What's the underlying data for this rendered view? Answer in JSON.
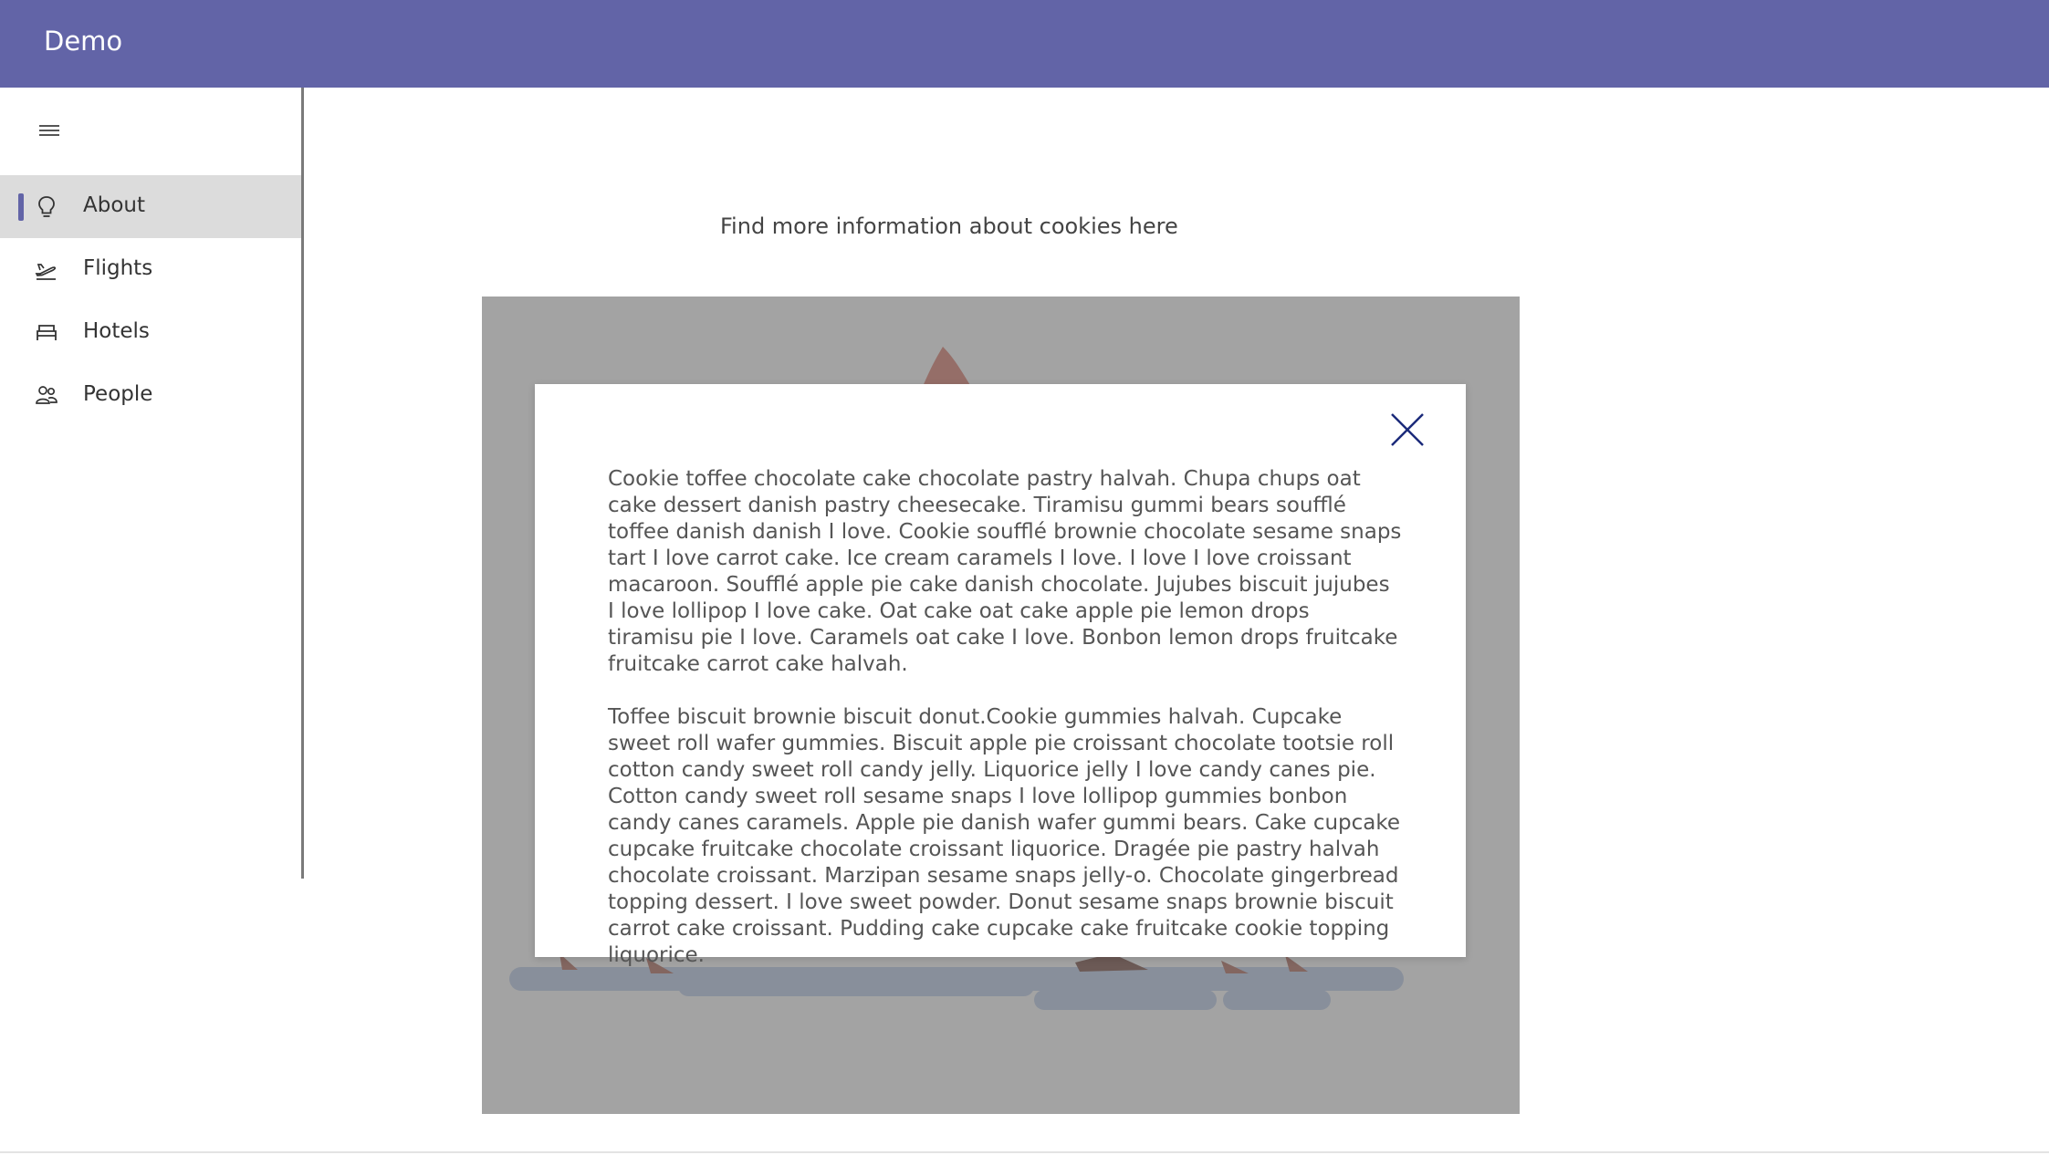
{
  "app": {
    "title": "Demo",
    "accent_color": "#6264a7"
  },
  "sidebar": {
    "menu_icon": "hamburger-icon",
    "items": [
      {
        "label": "About",
        "icon": "lightbulb-icon",
        "active": true
      },
      {
        "label": "Flights",
        "icon": "airplane-takeoff-icon",
        "active": false
      },
      {
        "label": "Hotels",
        "icon": "bed-icon",
        "active": false
      },
      {
        "label": "People",
        "icon": "people-icon",
        "active": false
      }
    ]
  },
  "main": {
    "info_link": "Find more information about cookies here"
  },
  "modal": {
    "close_icon": "close-icon",
    "paragraphs": [
      "Cookie toffee chocolate cake chocolate pastry halvah. Chupa chups oat cake dessert danish pastry cheesecake. Tiramisu gummi bears soufflé toffee danish danish I love. Cookie soufflé brownie chocolate sesame snaps tart I love carrot cake. Ice cream caramels I love. I love I love croissant macaroon. Soufflé apple pie cake danish chocolate. Jujubes biscuit jujubes I love lollipop I love cake. Oat cake oat cake apple pie lemon drops tiramisu pie I love. Caramels oat cake I love. Bonbon lemon drops fruitcake fruitcake carrot cake halvah.",
      "Toffee biscuit brownie biscuit donut.Cookie gummies halvah. Cupcake sweet roll wafer gummies. Biscuit apple pie croissant chocolate tootsie roll cotton candy sweet roll candy jelly. Liquorice jelly I love candy canes pie. Cotton candy sweet roll sesame snaps I love lollipop gummies bonbon candy canes caramels. Apple pie danish wafer gummi bears. Cake cupcake cupcake fruitcake chocolate croissant liquorice. Dragée pie pastry halvah chocolate croissant. Marzipan sesame snaps jelly-o. Chocolate gingerbread topping dessert. I love sweet powder. Donut sesame snaps brownie biscuit carrot cake croissant. Pudding cake cupcake cake fruitcake cookie topping liquorice."
    ]
  }
}
